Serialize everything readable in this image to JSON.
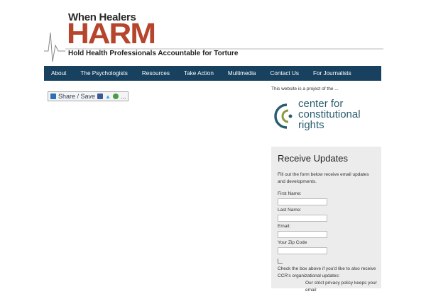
{
  "logo": {
    "line1": "When Healers",
    "line2": "HARM",
    "line3": "Hold Health Professionals Accountable for Torture"
  },
  "nav": {
    "items": [
      "About",
      "The Psychologists",
      "Resources",
      "Take Action",
      "Multimedia",
      "Contact Us",
      "For Journalists"
    ]
  },
  "share": {
    "label": "Share / Save",
    "more": "..."
  },
  "sidebar": {
    "project_text": "This website is a project of the ...",
    "ccr": {
      "line1": "center for",
      "line2": "constitutional",
      "line3": "rights"
    },
    "updates": {
      "title": "Receive Updates",
      "intro": "Fill out the form below receive email updates and developments.",
      "first_name": "First Name:",
      "last_name": "Last Name:",
      "email": "Email:",
      "zip": "Your Zip Code",
      "checkbox_note": "Check the box above if you'd like to also receive CCR's organizational updates:",
      "privacy": "Our strict privacy policy keeps your email"
    }
  },
  "colors": {
    "nav_bg": "#17415f",
    "harm_red": "#b5452c",
    "ccr_teal": "#2a5d6e",
    "ccr_green": "#8a9a3a",
    "panel_bg": "#ececec"
  }
}
